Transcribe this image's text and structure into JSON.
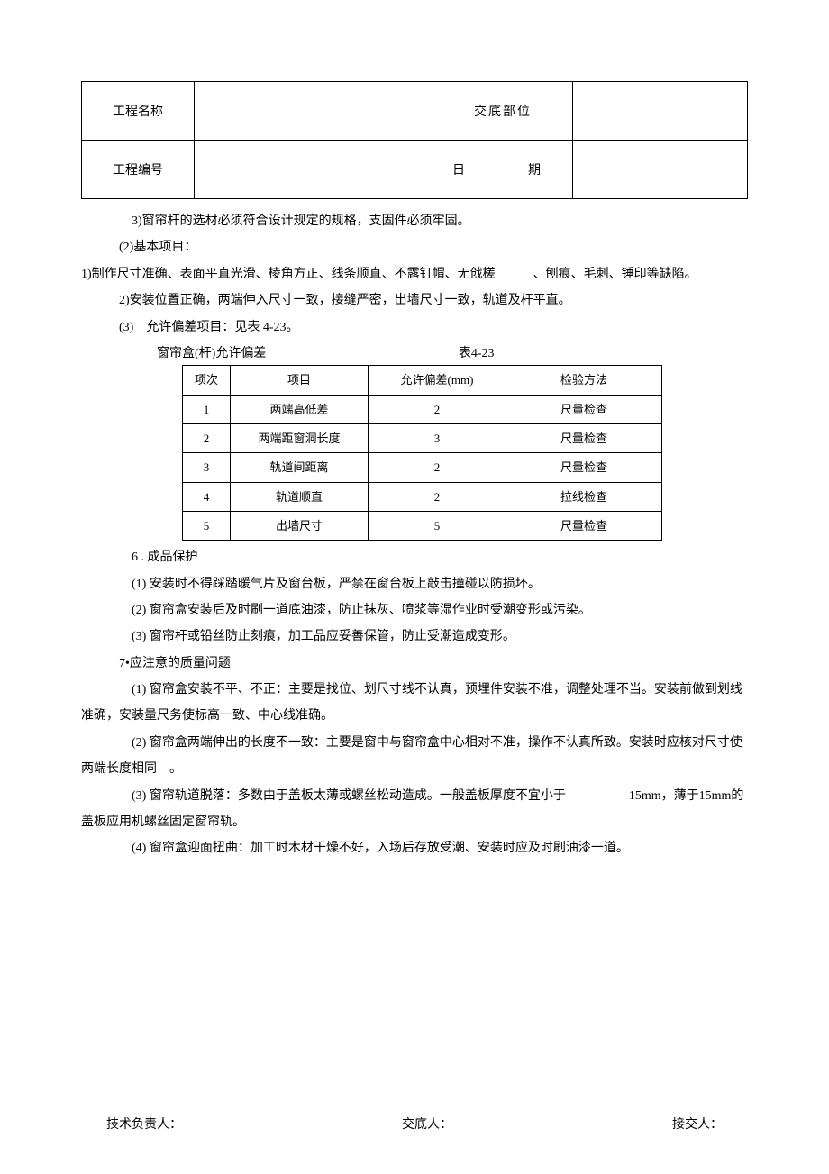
{
  "header": {
    "row1": {
      "label1": "工程名称",
      "label2": "交底部位"
    },
    "row2": {
      "label1": "工程编号",
      "label2": "日　　期"
    }
  },
  "lines": {
    "l1": "3)窗帘杆的选材必须符合设计规定的规格，支固件必须牢固。",
    "l2": "(2)基本项目：",
    "l3": "1)制作尺寸准确、表面平直光滑、棱角方正、线条顺直、不露钉帽、无戗槎　　　、刨痕、毛刺、锤印等缺陷。",
    "l4": "2)安装位置正确，两端伸入尺寸一致，接缝严密，出墙尺寸一致，轨道及杆平直。",
    "l5": "(3)　允许偏差项目：见表 4-23。",
    "tol_title_label": "窗帘盒(杆)允许偏差",
    "tol_title_num": "表4-23",
    "l6": "6 . 成品保护",
    "l7": "(1) 安装时不得踩踏暖气片及窗台板，严禁在窗台板上敲击撞碰以防损坏。",
    "l8": "(2) 窗帘盒安装后及时刷一道底油漆，防止抹灰、喷浆等湿作业时受潮变形或污染。",
    "l9": "(3) 窗帘杆或铅丝防止刻痕，加工品应妥善保管，防止受潮造成变形。",
    "l10": "7•应注意的质量问题",
    "l11": "(1) 窗帘盒安装不平、不正：主要是找位、划尺寸线不认真，预埋件安装不准，调整处理不当。安装前做到划线准确，安装量尺务使标高一致、中心线准确。",
    "l12": "(2) 窗帘盒两端伸出的长度不一致：主要是窗中与窗帘盒中心相对不准，操作不认真所致。安装时应核对尺寸使两端长度相同　。",
    "l13": "(3) 窗帘轨道脱落：多数由于盖板太薄或螺丝松动造成。一般盖板厚度不宜小于　　　　　15mm，薄于15mm的盖板应用机螺丝固定窗帘轨。",
    "l14": "(4) 窗帘盒迎面扭曲：加工时木材干燥不好，入场后存放受潮、安装时应及时刷油漆一道。"
  },
  "tol_table": {
    "headers": [
      "项次",
      "项目",
      "允许偏差(mm)",
      "检验方法"
    ],
    "rows": [
      [
        "1",
        "两端高低差",
        "2",
        "尺量检查"
      ],
      [
        "2",
        "两端距窗洞长度",
        "3",
        "尺量检查"
      ],
      [
        "3",
        "轨道间距离",
        "2",
        "尺量检查"
      ],
      [
        "4",
        "轨道顺直",
        "2",
        "拉线检查"
      ],
      [
        "5",
        "出墙尺寸",
        "5",
        "尺量检查"
      ]
    ]
  },
  "footer": {
    "a": "技术负责人：",
    "b": "交底人：",
    "c": "接交人："
  }
}
